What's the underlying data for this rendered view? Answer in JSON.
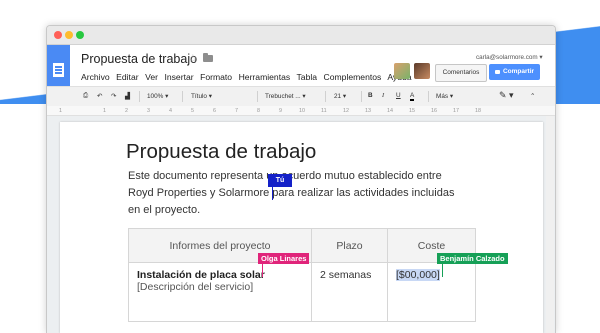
{
  "doc": {
    "title": "Propuesta de trabajo",
    "menu": [
      "Archivo",
      "Editar",
      "Ver",
      "Insertar",
      "Formato",
      "Herramientas",
      "Tabla",
      "Complementos",
      "Ayuda"
    ],
    "account_email": "carla@solarmore.com",
    "comments_label": "Comentarios",
    "share_label": "Compartir"
  },
  "toolbar": {
    "zoom": "100%",
    "style": "Título",
    "font": "Trebuchet ...",
    "size": "21",
    "more": "Más"
  },
  "ruler": {
    "marks": [
      "1",
      "1",
      "2",
      "3",
      "4",
      "5",
      "6",
      "7",
      "8",
      "9",
      "10",
      "11",
      "12",
      "13",
      "14",
      "15",
      "16",
      "17",
      "18"
    ]
  },
  "content": {
    "heading": "Propuesta de trabajo",
    "para_line1": "Este documento representa un acuerdo mutuo establecido entre",
    "para_line2": "Royd Properties y Solarmore para realizar las actividades incluidas",
    "para_line3": "en el proyecto.",
    "table": {
      "headers": [
        "Informes del proyecto",
        "Plazo",
        "Coste"
      ],
      "row1": {
        "name": "Instalación de placa solar",
        "desc": "[Descripción del servicio]",
        "plazo": "2 semanas",
        "coste": "[$00,000]"
      }
    }
  },
  "collaborators": {
    "you": "Tú",
    "olga": "Olga Linares",
    "benjamin": "Benjamín Calzado"
  },
  "colors": {
    "accent": "#4d90fe",
    "you": "#1421c8",
    "olga": "#e0247a",
    "benjamin": "#16a057"
  }
}
